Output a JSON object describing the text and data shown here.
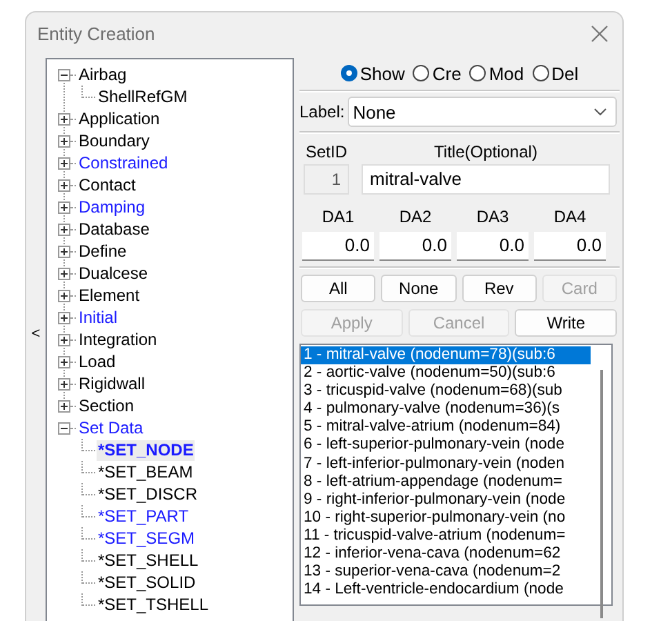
{
  "window": {
    "title": "Entity Creation"
  },
  "collapse_handle": "<",
  "tree": [
    {
      "label": "Airbag",
      "defined": false,
      "expanded": true,
      "selected": false,
      "children": [
        {
          "label": "ShellRefGM",
          "defined": false,
          "selected": false
        }
      ]
    },
    {
      "label": "Application",
      "defined": false,
      "expanded": false,
      "selected": false
    },
    {
      "label": "Boundary",
      "defined": false,
      "expanded": false,
      "selected": false
    },
    {
      "label": "Constrained",
      "defined": true,
      "expanded": false,
      "selected": false
    },
    {
      "label": "Contact",
      "defined": false,
      "expanded": false,
      "selected": false
    },
    {
      "label": "Damping",
      "defined": true,
      "expanded": false,
      "selected": false
    },
    {
      "label": "Database",
      "defined": false,
      "expanded": false,
      "selected": false
    },
    {
      "label": "Define",
      "defined": false,
      "expanded": false,
      "selected": false
    },
    {
      "label": "Dualcese",
      "defined": false,
      "expanded": false,
      "selected": false
    },
    {
      "label": "Element",
      "defined": false,
      "expanded": false,
      "selected": false
    },
    {
      "label": "Initial",
      "defined": true,
      "expanded": false,
      "selected": false
    },
    {
      "label": "Integration",
      "defined": false,
      "expanded": false,
      "selected": false
    },
    {
      "label": "Load",
      "defined": false,
      "expanded": false,
      "selected": false
    },
    {
      "label": "Rigidwall",
      "defined": false,
      "expanded": false,
      "selected": false
    },
    {
      "label": "Section",
      "defined": false,
      "expanded": false,
      "selected": false
    },
    {
      "label": "Set Data",
      "defined": true,
      "expanded": true,
      "selected": false,
      "children": [
        {
          "label": "*SET_NODE",
          "defined": true,
          "selected": true
        },
        {
          "label": "*SET_BEAM",
          "defined": false,
          "selected": false
        },
        {
          "label": "*SET_DISCR",
          "defined": false,
          "selected": false
        },
        {
          "label": "*SET_PART",
          "defined": true,
          "selected": false
        },
        {
          "label": "*SET_SEGM",
          "defined": true,
          "selected": false
        },
        {
          "label": "*SET_SHELL",
          "defined": false,
          "selected": false
        },
        {
          "label": "*SET_SOLID",
          "defined": false,
          "selected": false
        },
        {
          "label": "*SET_TSHELL",
          "defined": false,
          "selected": false
        }
      ]
    }
  ],
  "modes": [
    {
      "label": "Show",
      "selected": true
    },
    {
      "label": "Cre",
      "selected": false
    },
    {
      "label": "Mod",
      "selected": false
    },
    {
      "label": "Del",
      "selected": false
    }
  ],
  "label_field": {
    "label": "Label:",
    "value": "None"
  },
  "set_id": {
    "label": "SetID",
    "value": "1"
  },
  "title_field": {
    "label": "Title(Optional)",
    "value": "mitral-valve"
  },
  "attributes": [
    {
      "label": "DA1",
      "value": "0.0"
    },
    {
      "label": "DA2",
      "value": "0.0"
    },
    {
      "label": "DA3",
      "value": "0.0"
    },
    {
      "label": "DA4",
      "value": "0.0"
    }
  ],
  "selection_buttons": [
    {
      "label": "All",
      "disabled": false
    },
    {
      "label": "None",
      "disabled": false
    },
    {
      "label": "Rev",
      "disabled": false
    },
    {
      "label": "Card",
      "disabled": true
    }
  ],
  "action_buttons": [
    {
      "label": "Apply",
      "disabled": true
    },
    {
      "label": "Cancel",
      "disabled": true
    },
    {
      "label": "Write",
      "disabled": false
    }
  ],
  "sets": [
    {
      "label": "1 - mitral-valve (nodenum=78)(sub:6",
      "selected": true
    },
    {
      "label": "2 - aortic-valve (nodenum=50)(sub:6",
      "selected": false
    },
    {
      "label": "3 - tricuspid-valve (nodenum=68)(sub",
      "selected": false
    },
    {
      "label": "4 - pulmonary-valve (nodenum=36)(s",
      "selected": false
    },
    {
      "label": "5 - mitral-valve-atrium (nodenum=84)",
      "selected": false
    },
    {
      "label": "6 - left-superior-pulmonary-vein (node",
      "selected": false
    },
    {
      "label": "7 - left-inferior-pulmonary-vein (noden",
      "selected": false
    },
    {
      "label": "8 - left-atrium-appendage (nodenum=",
      "selected": false
    },
    {
      "label": "9 - right-inferior-pulmonary-vein (node",
      "selected": false
    },
    {
      "label": "10 - right-superior-pulmonary-vein (no",
      "selected": false
    },
    {
      "label": "11 - tricuspid-valve-atrium (nodenum=",
      "selected": false
    },
    {
      "label": "12 - inferior-vena-cava (nodenum=62",
      "selected": false
    },
    {
      "label": "13 - superior-vena-cava (nodenum=2",
      "selected": false
    },
    {
      "label": "14 - Left-ventricle-endocardium (node",
      "selected": false
    }
  ]
}
